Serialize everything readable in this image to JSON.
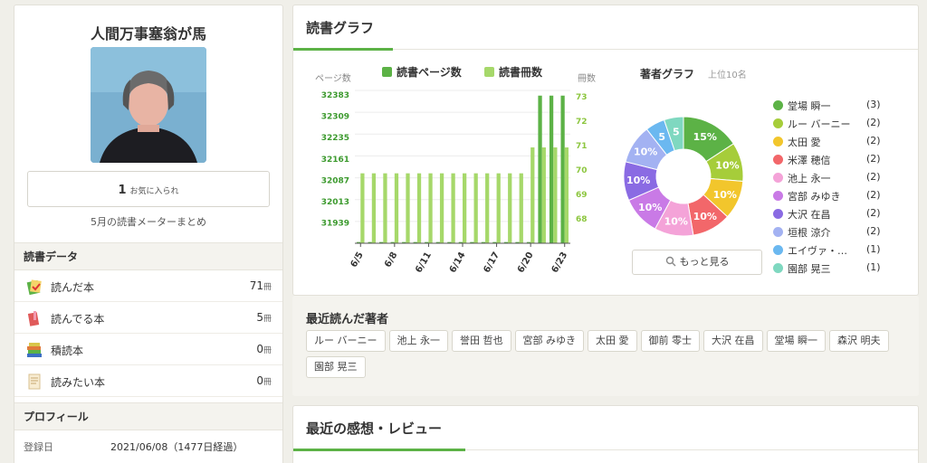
{
  "profile": {
    "user_name": "人間万事塞翁が馬",
    "favorites_count": "1",
    "favorites_label": "お気に入られ",
    "monthly_summary": "5月の読書メーターまとめ"
  },
  "reading_data": {
    "heading": "読書データ",
    "items": [
      {
        "label": "読んだ本",
        "count": "71",
        "unit": "冊",
        "icon": "read-book-icon"
      },
      {
        "label": "読んでる本",
        "count": "5",
        "unit": "冊",
        "icon": "reading-book-icon"
      },
      {
        "label": "積読本",
        "count": "0",
        "unit": "冊",
        "icon": "stacked-books-icon"
      },
      {
        "label": "読みたい本",
        "count": "0",
        "unit": "冊",
        "icon": "wishlist-book-icon"
      }
    ]
  },
  "profile_section": {
    "heading": "プロフィール",
    "registered_label": "登録日",
    "registered_value": "2021/06/08（1477日経過）"
  },
  "graph": {
    "title": "読書グラフ",
    "legend_pages": "読書ページ数",
    "legend_books": "読書冊数",
    "left_axis_label": "ページ数",
    "right_axis_label": "冊数",
    "pie_title": "著者グラフ",
    "pie_subtitle": "上位10名",
    "more_button": "もっと見る"
  },
  "colors": {
    "pages": "#5cb246",
    "books": "#a6d86a",
    "accent": "#5cb246"
  },
  "chart_data": [
    {
      "type": "bar",
      "x": [
        "6/5",
        "6/6",
        "6/7",
        "6/8",
        "6/9",
        "6/10",
        "6/11",
        "6/12",
        "6/13",
        "6/14",
        "6/15",
        "6/16",
        "6/17",
        "6/18",
        "6/19",
        "6/20",
        "6/21",
        "6/22",
        "6/23"
      ],
      "x_tick_labels": [
        "6/5",
        "6/8",
        "6/11",
        "6/14",
        "6/17",
        "6/20",
        "6/23"
      ],
      "y_left_ticks": [
        "32383",
        "32309",
        "32235",
        "32161",
        "32087",
        "32013",
        "31939"
      ],
      "y_right_ticks": [
        "73",
        "72",
        "71",
        "70",
        "69",
        "68"
      ],
      "series": [
        {
          "name": "読書ページ数",
          "axis": "left",
          "values": [
            31904,
            31904,
            31904,
            31904,
            31904,
            31904,
            31904,
            31904,
            31904,
            31904,
            31904,
            31904,
            31904,
            31904,
            31904,
            31904,
            32383,
            32383,
            32383
          ]
        },
        {
          "name": "読書冊数",
          "axis": "right",
          "values": [
            70,
            70,
            70,
            70,
            70,
            70,
            70,
            70,
            70,
            70,
            70,
            70,
            70,
            70,
            70,
            71,
            71,
            71,
            71
          ]
        }
      ],
      "ylim_left": [
        31900,
        32400
      ],
      "ylim_right": [
        67.3,
        73.2
      ]
    },
    {
      "type": "pie",
      "labels": [
        "堂場 瞬一",
        "ルー バーニー",
        "太田 愛",
        "米澤 穂信",
        "池上 永一",
        "宮部 みゆき",
        "大沢 在昌",
        "垣根 涼介",
        "エイヴァ・…",
        "園部 晃三"
      ],
      "values": [
        3,
        2,
        2,
        2,
        2,
        2,
        2,
        2,
        1,
        1
      ],
      "slice_labels": [
        "15%",
        "10%",
        "10%",
        "10%",
        "10%",
        "10%",
        "10%",
        "10%",
        "5",
        "5"
      ],
      "legend_counts": [
        "(3)",
        "(2)",
        "(2)",
        "(2)",
        "(2)",
        "(2)",
        "(2)",
        "(2)",
        "(1)",
        "(1)"
      ],
      "colors": [
        "#5cb246",
        "#a6cd3a",
        "#f2c62c",
        "#f2676a",
        "#f4a3d8",
        "#c97ae6",
        "#8a6be3",
        "#a3b2f2",
        "#6bb8f0",
        "#7fd8c0"
      ]
    }
  ],
  "recent_authors": {
    "title": "最近読んだ著者",
    "tags": [
      "ルー バーニー",
      "池上 永一",
      "誉田 哲也",
      "宮部 みゆき",
      "太田 愛",
      "御前 零士",
      "大沢 在昌",
      "堂場 瞬一",
      "森沢 明夫",
      "園部 晃三"
    ]
  },
  "reviews": {
    "title": "最近の感想・レビュー"
  }
}
